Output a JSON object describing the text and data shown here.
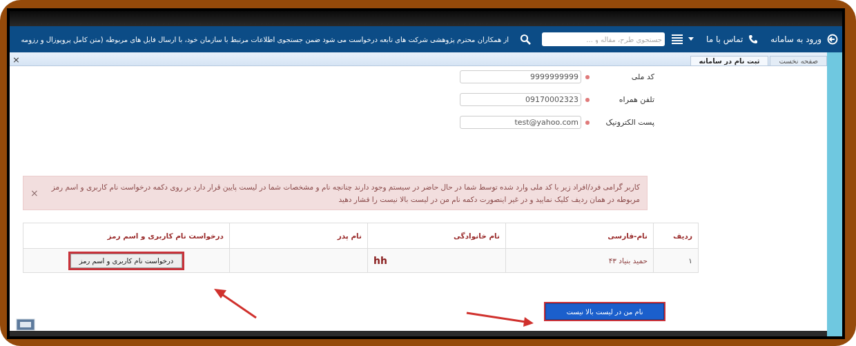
{
  "nav": {
    "login": "ورود به سامانه",
    "contact": "تماس با ما",
    "search": {
      "placeholder": "جستجوی طرح، مقاله و ..."
    },
    "marquee": "از همکاران محترم پژوهشی شرکت های تابعه درخواست می شود ضمن جستجوی اطلاعات مرتبط با سازمان خود، با ارسال فایل های مربوطه (متن کامل پروپوزال و رزومه"
  },
  "tabs": [
    {
      "label": "صفحه نخست",
      "selected": false
    },
    {
      "label": "ثبت نام در سامانه",
      "selected": true
    }
  ],
  "close_all": "×",
  "form": [
    {
      "label": "کد ملی",
      "value": "9999999999",
      "required": true
    },
    {
      "label": "تلفن همراه",
      "value": "09170002323",
      "required": true
    },
    {
      "label": "پست الکترونیک",
      "value": "test@yahoo.com",
      "required": true
    }
  ],
  "alert": {
    "text": "کاربر گرامی فرد/افراد زیر با کد ملی وارد شده توسط شما در حال حاضر در سیستم وجود دارند چنانچه نام و مشخصات شما در لیست پایین قرار دارد بر روی دکمه درخواست نام کاربری و اسم رمز مربوطه در همان ردیف کلیک نمایید و در غیر اینصورت دکمه نام من در لیست بالا نیست را فشار دهید",
    "close": "×"
  },
  "table": {
    "columns": [
      "ردیف",
      "نام-فارسی",
      "نام خانوادگی",
      "نام پدر",
      "درخواست نام کاربری و اسم رمز"
    ],
    "rows": [
      {
        "row": "۱",
        "name": "حمید بنیاد ۴۳",
        "family": "hh",
        "action": {
          "label": "درخواست نام کاربری و اسم رمز",
          "highlighted": true
        }
      }
    ]
  },
  "not_listed_button": {
    "label": "نام من در لیست بالا نیست",
    "highlighted": true
  }
}
